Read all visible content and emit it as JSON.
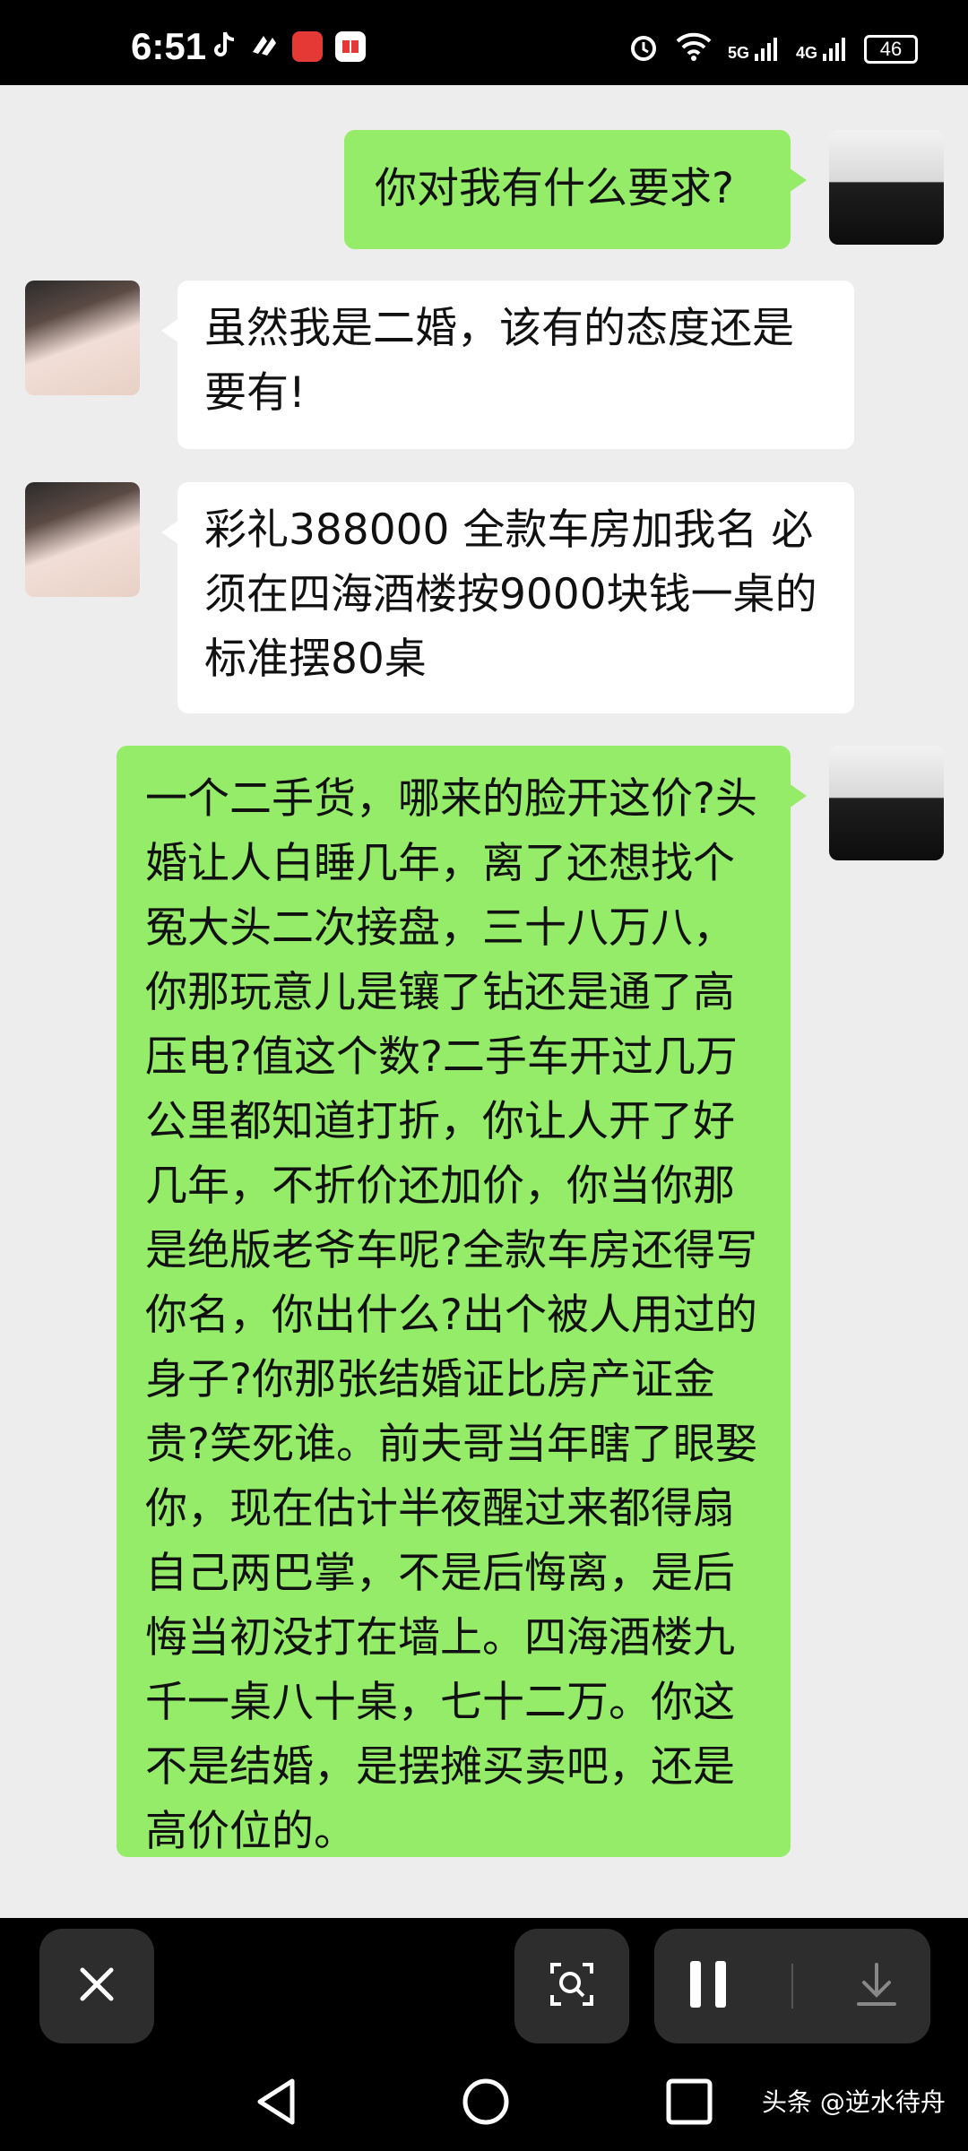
{
  "status": {
    "time": "6:51",
    "net1": "5G",
    "net2": "4G",
    "battery": "46"
  },
  "messages": [
    {
      "side": "right",
      "avatar": "male-avatar",
      "text": "你对我有什么要求?"
    },
    {
      "side": "left",
      "avatar": "female-avatar",
      "text": "虽然我是二婚，该有的态度还是要有!"
    },
    {
      "side": "left",
      "avatar": "female-avatar",
      "text": "彩礼388000 全款车房加我名 必须在四海酒楼按9000块钱一桌的标准摆80桌"
    },
    {
      "side": "right",
      "avatar": "male-avatar",
      "text": "一个二手货，哪来的脸开这价?头婚让人白睡几年，离了还想找个冤大头二次接盘，三十八万八，你那玩意儿是镶了钻还是通了高压电?值这个数?二手车开过几万公里都知道打折，你让人开了好几年，不折价还加价，你当你那是绝版老爷车呢?全款车房还得写你名，你出什么?出个被人用过的身子?你那张结婚证比房产证金贵?笑死谁。前夫哥当年瞎了眼娶你，现在估计半夜醒过来都得扇自己两巴掌，不是后悔离，是后悔当初没打在墙上。四海酒楼九千一桌八十桌，七十二万。你这不是结婚，是摆摊买卖吧，还是高价位的。"
    }
  ],
  "icons": {
    "close": "close-icon",
    "lens": "image-search-icon",
    "pause": "pause-icon",
    "download": "download-icon",
    "back": "back-icon",
    "home": "home-icon",
    "recents": "recents-icon"
  },
  "watermark": "头条 @逆水待舟",
  "colors": {
    "green_bubble": "#95ec69",
    "chat_bg": "#ededed"
  }
}
